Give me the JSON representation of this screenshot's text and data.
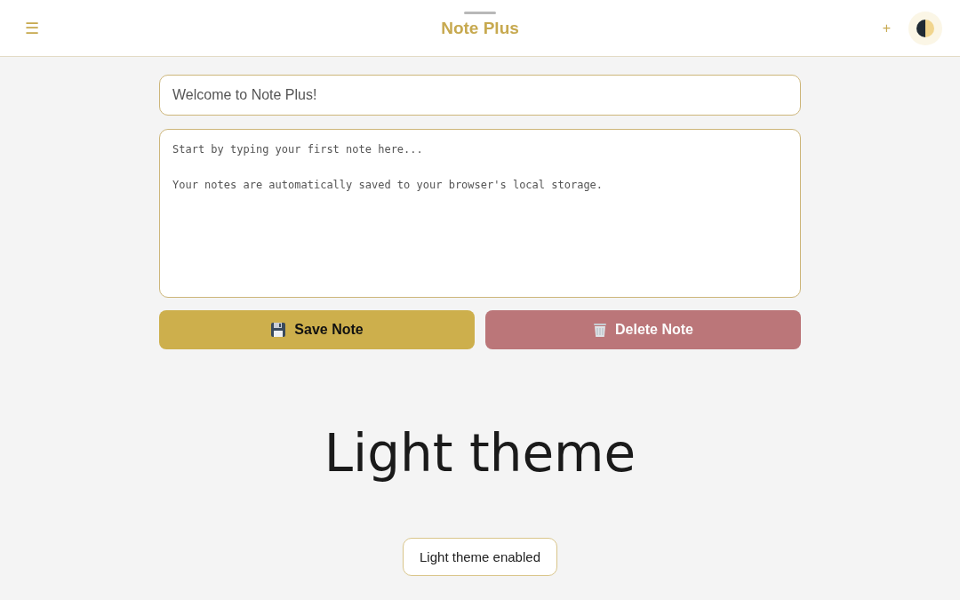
{
  "header": {
    "menu_glyph": "☰",
    "title": "Note Plus",
    "add_glyph": "+"
  },
  "note": {
    "title": "Welcome to Note Plus!",
    "body": "Start by typing your first note here...\n\nYour notes are automatically saved to your browser's local storage."
  },
  "buttons": [
    {
      "kind": "save",
      "label": "Save Note",
      "disabled": false
    },
    {
      "kind": "delete",
      "label": "Delete Note",
      "disabled": true
    }
  ],
  "heading": "Light theme",
  "toast": "Light theme enabled"
}
